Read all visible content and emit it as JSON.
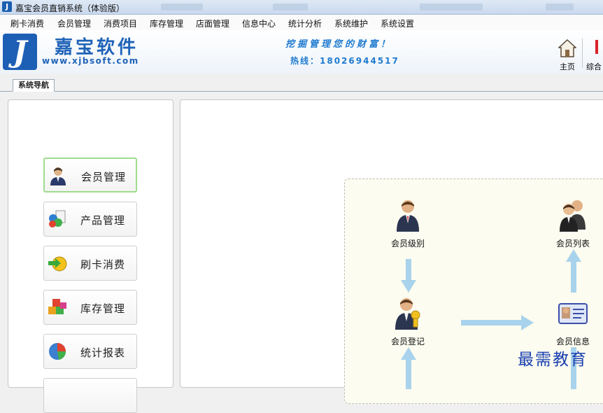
{
  "window": {
    "title": "嘉宝会员直销系统（体验版）"
  },
  "menu": [
    {
      "label": "刷卡消费"
    },
    {
      "label": "会员管理"
    },
    {
      "label": "消费项目"
    },
    {
      "label": "库存管理"
    },
    {
      "label": "店面管理"
    },
    {
      "label": "信息中心"
    },
    {
      "label": "统计分析"
    },
    {
      "label": "系统维护"
    },
    {
      "label": "系统设置"
    }
  ],
  "banner": {
    "logo_letter": "J",
    "brand_name": "嘉宝软件",
    "brand_url": "www.xjbsoft.com",
    "slogan": "挖掘管理您的财富！",
    "hotline": "热线：18026944517"
  },
  "toolbar": {
    "home_label": "主页",
    "next_label": "综合"
  },
  "tabs": [
    {
      "label": "系统导航"
    }
  ],
  "nav": [
    {
      "label": "会员管理",
      "icon": "member-icon",
      "active": true
    },
    {
      "label": "产品管理",
      "icon": "product-icon",
      "active": false
    },
    {
      "label": "刷卡消费",
      "icon": "card-swipe-icon",
      "active": false
    },
    {
      "label": "库存管理",
      "icon": "inventory-icon",
      "active": false
    },
    {
      "label": "统计报表",
      "icon": "statistics-icon",
      "active": false
    }
  ],
  "flow": {
    "nodes": [
      {
        "label": "会员级别",
        "icon": "member-level-icon"
      },
      {
        "label": "会员列表",
        "icon": "member-list-icon"
      },
      {
        "label": "会员登记",
        "icon": "member-register-icon"
      },
      {
        "label": "会员信息",
        "icon": "member-info-icon"
      }
    ]
  },
  "watermark": "最需教育",
  "colors": {
    "brand_blue": "#1f63b8",
    "arrow_blue": "#a9d3ec",
    "active_border": "#9fdc8f",
    "flow_bg": "#fcfcf0"
  }
}
